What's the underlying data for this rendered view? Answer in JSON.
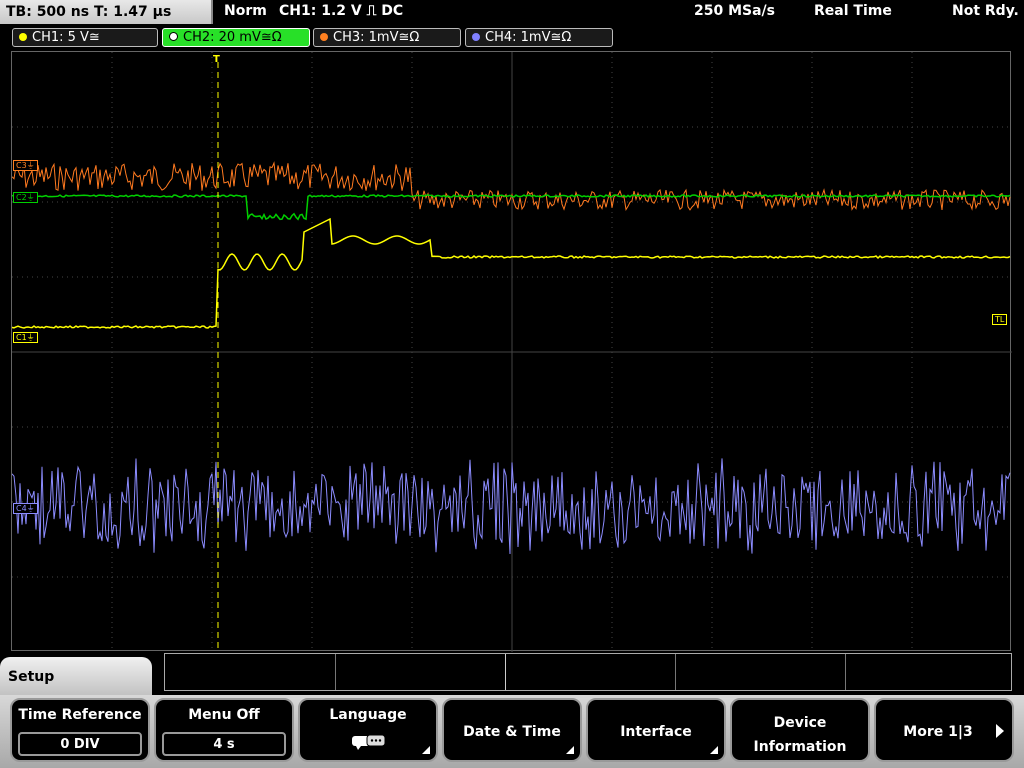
{
  "status_bar": {
    "timebase": "TB: 500 ns   T: 1.47 µs",
    "mode": "Norm",
    "trigger": "CH1: 1.2 V ⎍ DC",
    "sample_rate": "250 MSa/s",
    "acq_mode": "Real Time",
    "state": "Not Rdy."
  },
  "channels": [
    {
      "label": "CH1: 5 V≅",
      "color": "#ffff00",
      "active": false
    },
    {
      "label": "CH2: 20 mV≅Ω",
      "color": "#00e000",
      "active": true
    },
    {
      "label": "CH3: 1mV≅Ω",
      "color": "#ff8020",
      "active": false
    },
    {
      "label": "CH4: 1mV≅Ω",
      "color": "#8080ff",
      "active": false
    }
  ],
  "markers": {
    "ch3": "C3⏚",
    "ch2": "C2⏚",
    "ch1": "C1⏚",
    "ch4": "C4⏚",
    "trigger_level": "TL",
    "trigger_pos": "T"
  },
  "trace_colors": {
    "ch1": "#ffff00",
    "ch2": "#00d000",
    "ch3": "#ff7a20",
    "ch4": "#8c8cff"
  },
  "menu": {
    "title": "Setup",
    "time_reference": {
      "label": "Time Reference",
      "value": "0 DIV"
    },
    "menu_off": {
      "label": "Menu Off",
      "value": "4 s"
    },
    "language": {
      "label": "Language"
    },
    "date_time": {
      "label": "Date & Time"
    },
    "interface": {
      "label": "Interface"
    },
    "device_information": {
      "line1": "Device",
      "line2": "Information"
    },
    "more": {
      "label": "More 1|3"
    }
  }
}
